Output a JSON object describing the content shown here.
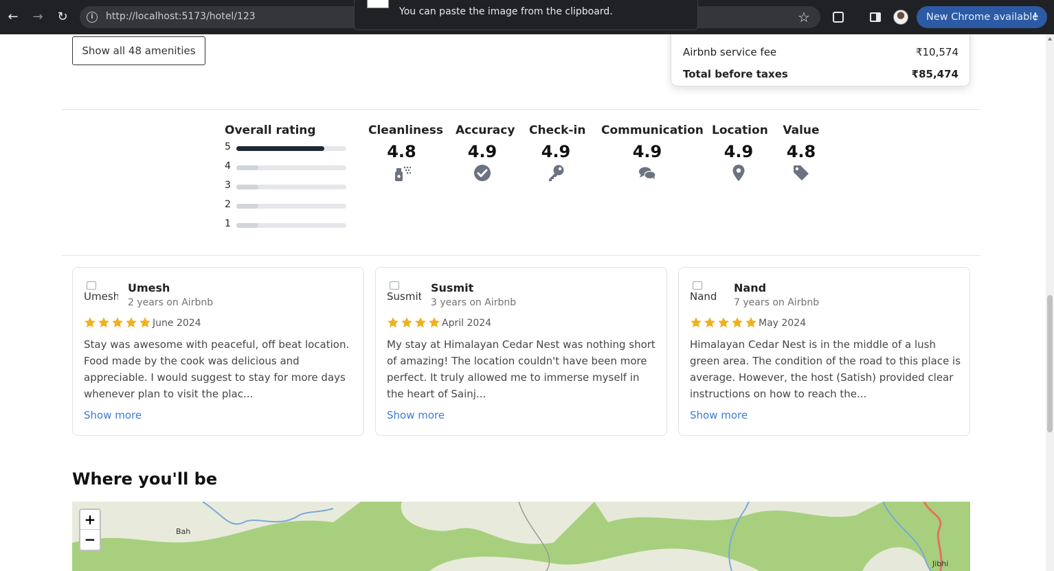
{
  "browser": {
    "url": "http://localhost:5173/hotel/123",
    "update_label": "New Chrome available",
    "toast_text": "You can paste the image from the clipboard."
  },
  "amenities": {
    "show_all_label": "Show all 48 amenities"
  },
  "price": {
    "rows": [
      {
        "label": "Airbnb service fee",
        "amount": "₹10,574"
      },
      {
        "label": "Total before taxes",
        "amount": "₹85,474"
      }
    ]
  },
  "ratings": {
    "overall_label": "Overall rating",
    "distribution": [
      {
        "stars": "5",
        "fill": 0.8
      },
      {
        "stars": "4",
        "fill": 0.2
      },
      {
        "stars": "3",
        "fill": 0.2
      },
      {
        "stars": "2",
        "fill": 0.2
      },
      {
        "stars": "1",
        "fill": 0.2
      }
    ],
    "categories": [
      {
        "label": "Cleanliness",
        "value": "4.8",
        "icon": "spray-bottle-icon"
      },
      {
        "label": "Accuracy",
        "value": "4.9",
        "icon": "check-circle-icon"
      },
      {
        "label": "Check-in",
        "value": "4.9",
        "icon": "key-icon"
      },
      {
        "label": "Communication",
        "value": "4.9",
        "icon": "chat-bubbles-icon"
      },
      {
        "label": "Location",
        "value": "4.9",
        "icon": "map-pin-icon"
      },
      {
        "label": "Value",
        "value": "4.8",
        "icon": "price-tag-icon"
      }
    ]
  },
  "reviews": [
    {
      "avatar_alt": "Umesh",
      "name": "Umesh",
      "tenure": "2 years on Airbnb",
      "stars": 5,
      "date": "June 2024",
      "text": "Stay was awesome with peaceful, off beat location. Food made by the cook was delicious and appreciable. I would suggest to stay for more days whenever plan to visit the plac...",
      "more": "Show more"
    },
    {
      "avatar_alt": "Susmit",
      "name": "Susmit",
      "tenure": "3 years on Airbnb",
      "stars": 4,
      "date": "April 2024",
      "text": "My stay at Himalayan Cedar Nest was nothing short of amazing! The location couldn't have been more perfect. It truly allowed me to immerse myself in the heart of Sainj...",
      "more": "Show more"
    },
    {
      "avatar_alt": "Nand",
      "name": "Nand",
      "tenure": "7 years on Airbnb",
      "stars": 5,
      "date": "May 2024",
      "text": "Himalayan Cedar Nest is in the middle of a lush green area. The condition of the road to this place is average. However, the host (Satish) provided clear instructions on how to reach the...",
      "more": "Show more"
    }
  ],
  "location": {
    "title": "Where you'll be",
    "zoom_in": "+",
    "zoom_out": "−",
    "map_labels": [
      "Bah",
      "Jibhi"
    ]
  },
  "colors": {
    "star": "#f2b01e",
    "link": "#3b7bd8",
    "icon": "#6b7280",
    "chrome_update": "#2c5aa5"
  }
}
